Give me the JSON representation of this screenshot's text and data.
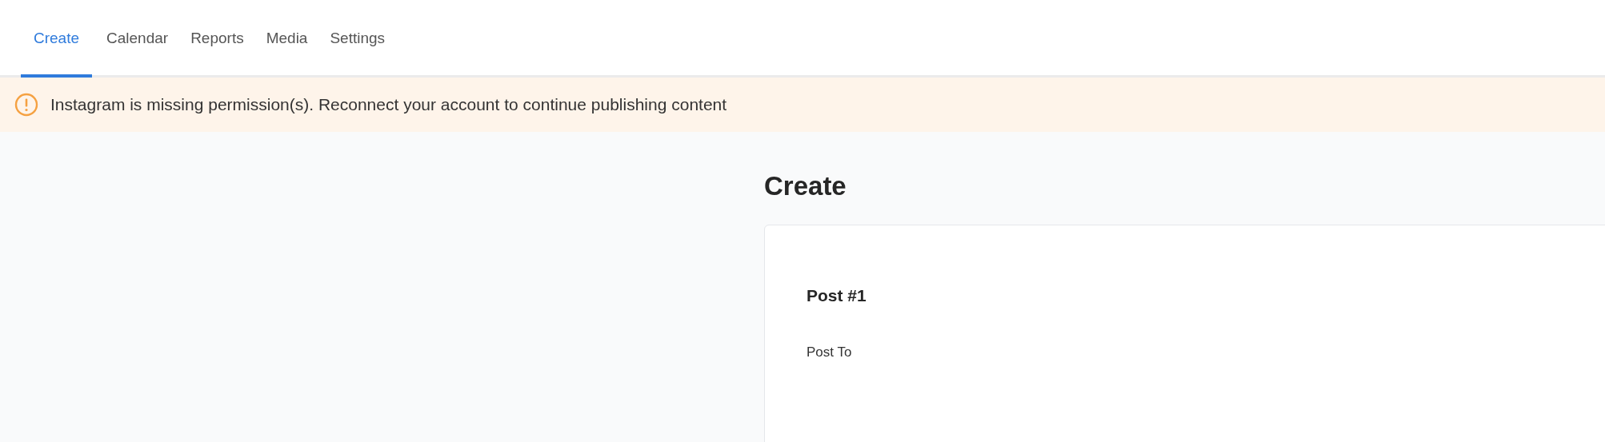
{
  "tabs": [
    {
      "label": "Create",
      "selected": true
    },
    {
      "label": "Calendar",
      "selected": false
    },
    {
      "label": "Reports",
      "selected": false
    },
    {
      "label": "Media",
      "selected": false
    },
    {
      "label": "Settings",
      "selected": false
    }
  ],
  "alert": {
    "message": "Instagram is missing permission(s). Reconnect your account to continue publishing content"
  },
  "page_title": "Create",
  "card": {
    "post_title": "Post #1",
    "field_label": "Post To"
  }
}
